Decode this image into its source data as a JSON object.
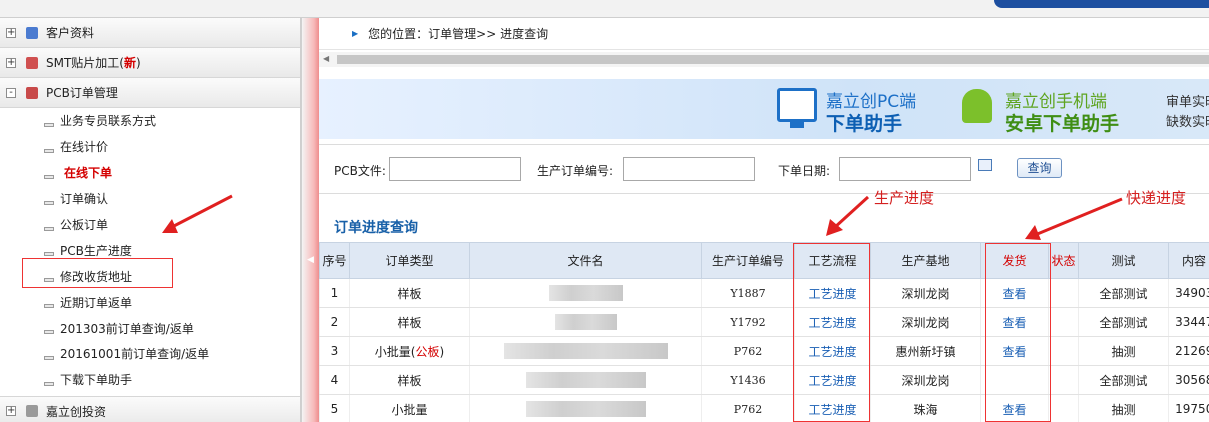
{
  "sidebar": {
    "groups": [
      {
        "label": "客户资料",
        "expand": "+"
      },
      {
        "label": "SMT贴片加工(",
        "badge": "新",
        "suffix": ")",
        "expand": "+"
      },
      {
        "label": "PCB订单管理",
        "expand": "-"
      },
      {
        "label": "嘉立创投资",
        "expand": "+"
      }
    ],
    "items": [
      {
        "label": "业务专员联系方式"
      },
      {
        "label": "在线计价"
      },
      {
        "label": "在线下单",
        "active": true
      },
      {
        "label": "订单确认"
      },
      {
        "label": "公板订单"
      },
      {
        "label": "PCB生产进度"
      },
      {
        "label": "修改收货地址"
      },
      {
        "label": "近期订单返单"
      },
      {
        "label": "201303前订单查询/返单"
      },
      {
        "label": "20161001前订单查询/返单"
      },
      {
        "label": "下载下单助手"
      }
    ]
  },
  "breadcrumb": {
    "text": "您的位置：订单管理>> 进度查询"
  },
  "banner": {
    "pc_line1": "嘉立创PC端",
    "pc_line2": "下单助手",
    "mobile_line1": "嘉立创手机端",
    "mobile_line2": "安卓下单助手",
    "side_line1": "审单实时",
    "side_line2": "缺数实时"
  },
  "search": {
    "pcb_file_label": "PCB文件:",
    "order_no_label": "生产订单编号:",
    "date_label": "下单日期:",
    "query_button": "查询"
  },
  "section_title": "订单进度查询",
  "annotations": {
    "production": "生产进度",
    "express": "快递进度"
  },
  "table": {
    "headers": [
      "序号",
      "订单类型",
      "文件名",
      "生产订单编号",
      "工艺流程",
      "生产基地",
      "发货",
      "状态",
      "测试",
      "内容"
    ],
    "rows": [
      {
        "no": "1",
        "type": "样板",
        "type_note": "",
        "order": "Y1887",
        "process": "工艺进度",
        "base": "深圳龙岗",
        "ship": "查看",
        "status": "",
        "test": "全部测试",
        "content": "34903"
      },
      {
        "no": "2",
        "type": "样板",
        "type_note": "",
        "order": "Y1792",
        "process": "工艺进度",
        "base": "深圳龙岗",
        "ship": "查看",
        "status": "",
        "test": "全部测试",
        "content": "33447"
      },
      {
        "no": "3",
        "type": "小批量(",
        "type_note": "公板",
        "type_tail": ")",
        "order": "P762",
        "process": "工艺进度",
        "base": "惠州新圩镇",
        "ship": "查看",
        "status": "",
        "test": "抽测",
        "content": "21269"
      },
      {
        "no": "4",
        "type": "样板",
        "type_note": "",
        "order": "Y1436",
        "process": "工艺进度",
        "base": "深圳龙岗",
        "ship": "",
        "status": "",
        "test": "全部测试",
        "content": "30568"
      },
      {
        "no": "5",
        "type": "小批量",
        "type_note": "",
        "order": "P762",
        "process": "工艺进度",
        "base": "珠海",
        "ship": "查看",
        "status": "",
        "test": "抽测",
        "content": "19750"
      }
    ]
  },
  "colors": {
    "accent": "#1860a8",
    "highlight": "#e33333",
    "alert": "#d40000"
  }
}
